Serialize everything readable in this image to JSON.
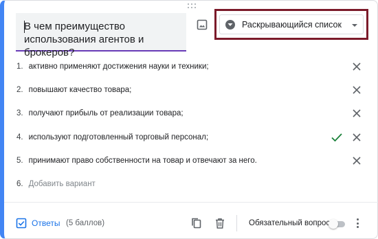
{
  "question": {
    "title": "В чем преимущество использования агентов и брокеров?"
  },
  "type_select": {
    "value": "Раскрывающийся список",
    "icon": "dropdown-circle-icon"
  },
  "options": [
    {
      "num": "1.",
      "text": "активно применяют достижения науки и техники;",
      "correct": false
    },
    {
      "num": "2.",
      "text": "повышают качество товара;",
      "correct": false
    },
    {
      "num": "3.",
      "text": "получают прибыль от реализации товара;",
      "correct": false
    },
    {
      "num": "4.",
      "text": "используют подготовленный торговый персонал;",
      "correct": true
    },
    {
      "num": "5.",
      "text": "принимают право собственности на товар и отвечают за него.",
      "correct": false
    }
  ],
  "add_option": {
    "num": "6.",
    "text": "Добавить вариант"
  },
  "footer": {
    "answers_label": "Ответы",
    "points": "(5 баллов)",
    "required_label": "Обязательный вопрос",
    "required_on": false
  },
  "colors": {
    "accent_blue": "#1a73e8",
    "question_underline": "#673ab7",
    "highlight_border": "#7b1a2a",
    "correct_check": "#188038"
  }
}
